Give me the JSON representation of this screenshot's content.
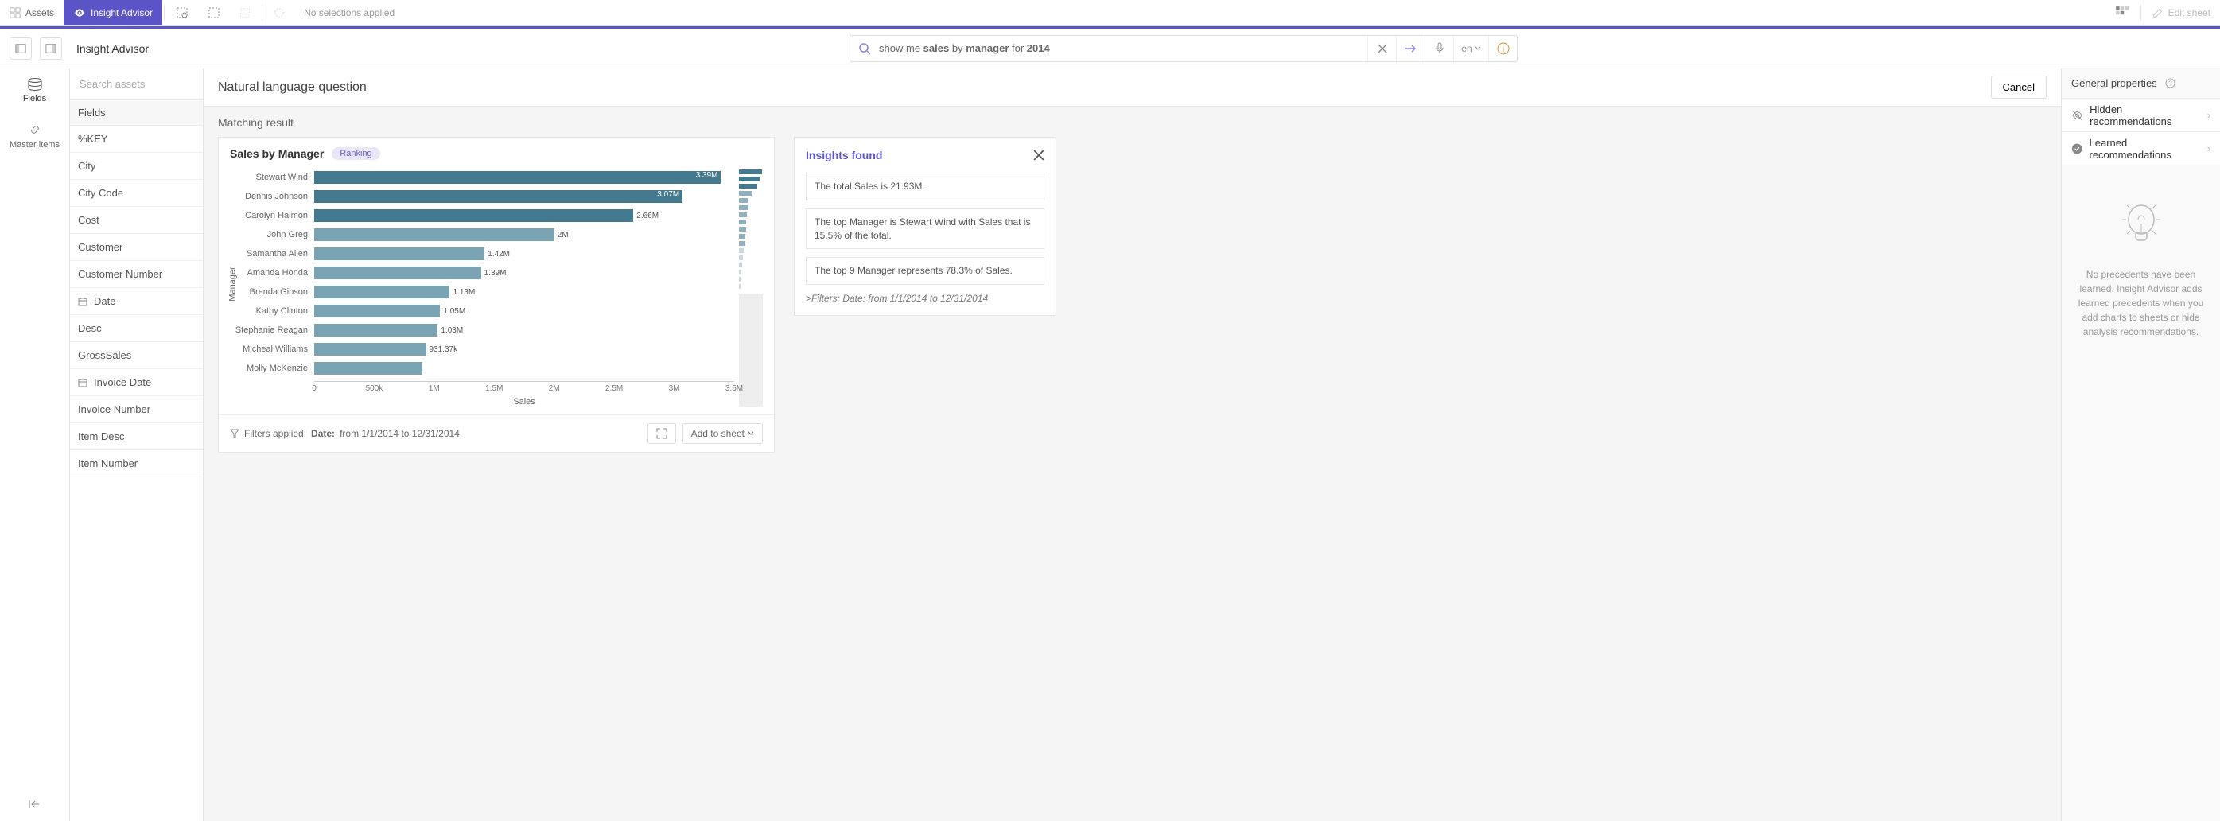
{
  "topbar": {
    "assets": "Assets",
    "insight_advisor": "Insight Advisor",
    "no_selections": "No selections applied",
    "edit_sheet": "Edit sheet"
  },
  "secbar": {
    "title": "Insight Advisor",
    "search_html": "show me <b>sales</b> by <b>manager</b> for <b>2014</b>",
    "lang": "en"
  },
  "rail": {
    "fields": "Fields",
    "master": "Master items"
  },
  "fields": {
    "search_placeholder": "Search assets",
    "header": "Fields",
    "items": [
      {
        "label": "%KEY",
        "icon": ""
      },
      {
        "label": "City",
        "icon": ""
      },
      {
        "label": "City Code",
        "icon": ""
      },
      {
        "label": "Cost",
        "icon": ""
      },
      {
        "label": "Customer",
        "icon": ""
      },
      {
        "label": "Customer Number",
        "icon": ""
      },
      {
        "label": "Date",
        "icon": "cal"
      },
      {
        "label": "Desc",
        "icon": ""
      },
      {
        "label": "GrossSales",
        "icon": ""
      },
      {
        "label": "Invoice Date",
        "icon": "cal"
      },
      {
        "label": "Invoice Number",
        "icon": ""
      },
      {
        "label": "Item Desc",
        "icon": ""
      },
      {
        "label": "Item Number",
        "icon": ""
      }
    ]
  },
  "content": {
    "qtitle": "Natural language question",
    "cancel": "Cancel",
    "matching": "Matching result"
  },
  "chart": {
    "title": "Sales by Manager",
    "badge": "Ranking",
    "ylabel": "Manager",
    "xlabel": "Sales",
    "filters_label": "Filters applied:",
    "filters_field": "Date:",
    "filters_value": "from 1/1/2014 to 12/31/2014",
    "add_to_sheet": "Add to sheet"
  },
  "chart_data": {
    "type": "bar",
    "orientation": "horizontal",
    "title": "Sales by Manager",
    "xlabel": "Sales",
    "ylabel": "Manager",
    "xlim": [
      0,
      3500000
    ],
    "xticks": [
      {
        "v": 0,
        "l": "0"
      },
      {
        "v": 500000,
        "l": "500k"
      },
      {
        "v": 1000000,
        "l": "1M"
      },
      {
        "v": 1500000,
        "l": "1.5M"
      },
      {
        "v": 2000000,
        "l": "2M"
      },
      {
        "v": 2500000,
        "l": "2.5M"
      },
      {
        "v": 3000000,
        "l": "3M"
      },
      {
        "v": 3500000,
        "l": "3.5M"
      }
    ],
    "categories": [
      "Stewart Wind",
      "Dennis Johnson",
      "Carolyn Halmon",
      "John Greg",
      "Samantha Allen",
      "Amanda Honda",
      "Brenda Gibson",
      "Kathy Clinton",
      "Stephanie Reagan",
      "Micheal Williams",
      "Molly McKenzie"
    ],
    "values": [
      3390000,
      3070000,
      2660000,
      2000000,
      1420000,
      1390000,
      1130000,
      1050000,
      1030000,
      931370,
      900000
    ],
    "value_labels": [
      "3.39M",
      "3.07M",
      "2.66M",
      "2M",
      "1.42M",
      "1.39M",
      "1.13M",
      "1.05M",
      "1.03M",
      "931.37k",
      ""
    ],
    "highlight_count": 3
  },
  "insights": {
    "title": "Insights found",
    "items": [
      "The total Sales is 21.93M.",
      "The top Manager is Stewart Wind with Sales that is 15.5% of the total.",
      "The top 9 Manager represents 78.3% of Sales."
    ],
    "filters": ">Filters: Date: from 1/1/2014 to 12/31/2014"
  },
  "rpanel": {
    "header": "General properties",
    "hidden": "Hidden recommendations",
    "learned": "Learned recommendations",
    "msg": "No precedents have been learned. Insight Advisor adds learned precedents when you add charts to sheets or hide analysis recommendations."
  }
}
